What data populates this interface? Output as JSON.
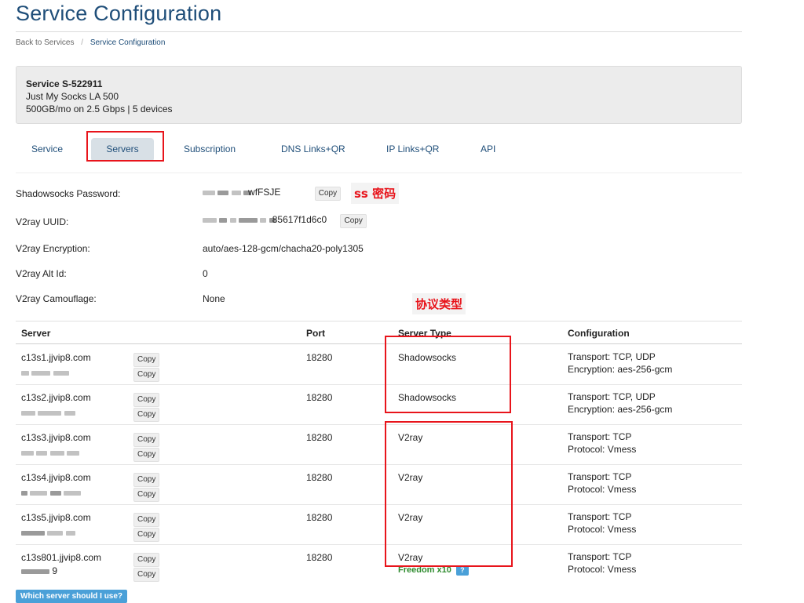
{
  "page": {
    "title": "Service Configuration"
  },
  "breadcrumb": {
    "back": "Back to Services",
    "current": "Service Configuration"
  },
  "service": {
    "id": "Service S-522911",
    "plan": "Just My Socks LA 500",
    "details": "500GB/mo on 2.5 Gbps | 5 devices"
  },
  "tabs": [
    {
      "label": "Service"
    },
    {
      "label": "Servers"
    },
    {
      "label": "Subscription"
    },
    {
      "label": "DNS Links+QR"
    },
    {
      "label": "IP Links+QR"
    },
    {
      "label": "API"
    }
  ],
  "info": {
    "ss_password_label": "Shadowsocks Password:",
    "ss_password_suffix": "wfFSJE",
    "uuid_label": "V2ray UUID:",
    "uuid_suffix": "85617f1d6c0",
    "encryption_label": "V2ray Encryption:",
    "encryption_value": "auto/aes-128-gcm/chacha20-poly1305",
    "altid_label": "V2ray Alt Id:",
    "altid_value": "0",
    "camouflage_label": "V2ray Camouflage:",
    "camouflage_value": "None",
    "copy_label": "Copy"
  },
  "table": {
    "headers": {
      "server": "Server",
      "port": "Port",
      "type": "Server Type",
      "config": "Configuration"
    },
    "rows": [
      {
        "host": "c13s1.jjvip8.com",
        "ip_tail": "",
        "port": "18280",
        "type": "Shadowsocks",
        "cfg1": "Transport: TCP, UDP",
        "cfg2": "Encryption: aes-256-gcm"
      },
      {
        "host": "c13s2.jjvip8.com",
        "ip_tail": "",
        "port": "18280",
        "type": "Shadowsocks",
        "cfg1": "Transport: TCP, UDP",
        "cfg2": "Encryption: aes-256-gcm"
      },
      {
        "host": "c13s3.jjvip8.com",
        "ip_tail": "",
        "port": "18280",
        "type": "V2ray",
        "cfg1": "Transport: TCP",
        "cfg2": "Protocol: Vmess"
      },
      {
        "host": "c13s4.jjvip8.com",
        "ip_tail": "",
        "port": "18280",
        "type": "V2ray",
        "cfg1": "Transport: TCP",
        "cfg2": "Protocol: Vmess"
      },
      {
        "host": "c13s5.jjvip8.com",
        "ip_tail": "",
        "port": "18280",
        "type": "V2ray",
        "cfg1": "Transport: TCP",
        "cfg2": "Protocol: Vmess"
      },
      {
        "host": "c13s801.jjvip8.com",
        "ip_tail": "9",
        "port": "18280",
        "type": "V2ray",
        "cfg1": "Transport: TCP",
        "cfg2": "Protocol: Vmess"
      }
    ],
    "freedom_label": "Freedom x10",
    "help_icon": "?"
  },
  "which_button": "Which server should I use?",
  "annotations": {
    "ss_label": "ss 密码",
    "protocol_label": "协议类型",
    "color": "#e8141b"
  }
}
